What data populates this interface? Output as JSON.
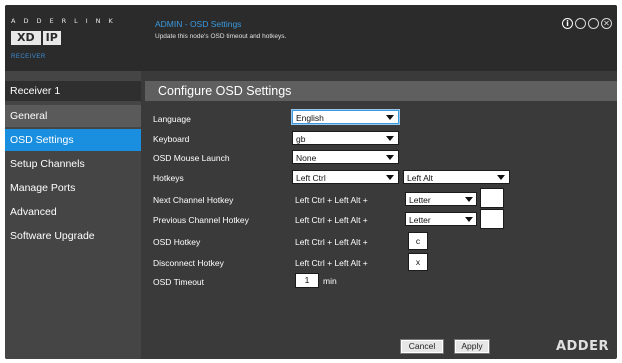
{
  "logo": {
    "brand_spaced": "ADDERLINK",
    "brand_xd": "XD",
    "brand_ip": "IP",
    "role": "RECEIVER"
  },
  "header": {
    "title": "ADMIN - OSD Settings",
    "subtitle": "Update this node's OSD timeout and hotkeys.",
    "icons": [
      "info-icon",
      "circle-icon",
      "circle-icon",
      "close-icon"
    ]
  },
  "sidebar": {
    "receiver": "Receiver 1",
    "items": [
      {
        "label": "General"
      },
      {
        "label": "OSD Settings"
      },
      {
        "label": "Setup Channels"
      },
      {
        "label": "Manage Ports"
      },
      {
        "label": "Advanced"
      },
      {
        "label": "Software Upgrade"
      }
    ]
  },
  "main": {
    "heading": "Configure OSD Settings",
    "language": {
      "label": "Language",
      "value": "English"
    },
    "keyboard": {
      "label": "Keyboard",
      "value": "gb"
    },
    "mouse_launch": {
      "label": "OSD Mouse Launch",
      "value": "None"
    },
    "hotkeys": {
      "label": "Hotkeys",
      "value1": "Left Ctrl",
      "value2": "Left Alt"
    },
    "next_channel": {
      "label": "Next Channel Hotkey",
      "prefix": "Left Ctrl + Left Alt +",
      "select": "Letter",
      "key": ""
    },
    "prev_channel": {
      "label": "Previous Channel Hotkey",
      "prefix": "Left Ctrl + Left Alt +",
      "select": "Letter",
      "key": ""
    },
    "osd_hotkey": {
      "label": "OSD Hotkey",
      "prefix": "Left Ctrl + Left Alt +",
      "key": "c"
    },
    "disconnect": {
      "label": "Disconnect Hotkey",
      "prefix": "Left Ctrl + Left Alt +",
      "key": "x"
    },
    "timeout": {
      "label": "OSD Timeout",
      "value": "1",
      "unit": "min"
    }
  },
  "footer": {
    "cancel": "Cancel",
    "apply": "Apply",
    "brand": "ADDER"
  }
}
